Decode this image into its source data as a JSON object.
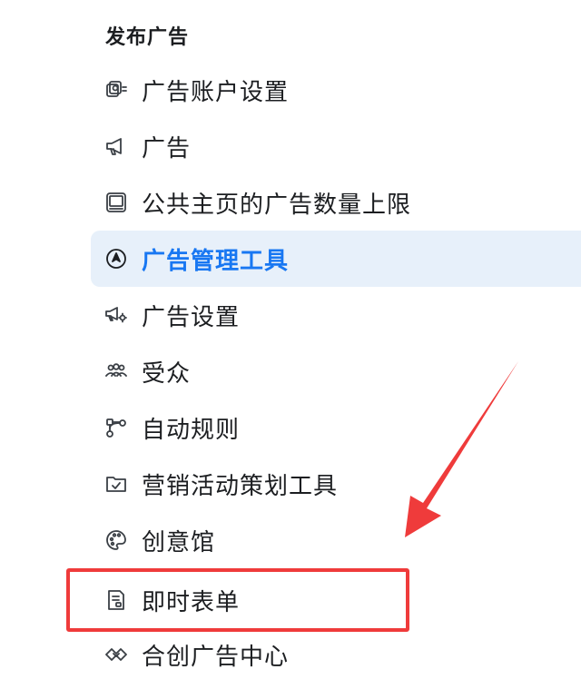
{
  "section": {
    "title": "发布广告"
  },
  "menu": {
    "items": [
      {
        "label": "广告账户设置",
        "icon": "ad-account-settings-icon"
      },
      {
        "label": "广告",
        "icon": "megaphone-icon"
      },
      {
        "label": "公共主页的广告数量上限",
        "icon": "page-limit-icon"
      },
      {
        "label": "广告管理工具",
        "icon": "ads-manager-icon",
        "active": true
      },
      {
        "label": "广告设置",
        "icon": "megaphone-gear-icon"
      },
      {
        "label": "受众",
        "icon": "audience-icon"
      },
      {
        "label": "自动规则",
        "icon": "automated-rules-icon"
      },
      {
        "label": "营销活动策划工具",
        "icon": "folder-check-icon"
      },
      {
        "label": "创意馆",
        "icon": "palette-icon"
      },
      {
        "label": "即时表单",
        "icon": "instant-form-icon"
      },
      {
        "label": "合创广告中心",
        "icon": "handshake-icon"
      }
    ]
  },
  "colors": {
    "active_text": "#1877f2",
    "active_bg": "#e7f0fa",
    "annotation": "#ef3b3b"
  }
}
